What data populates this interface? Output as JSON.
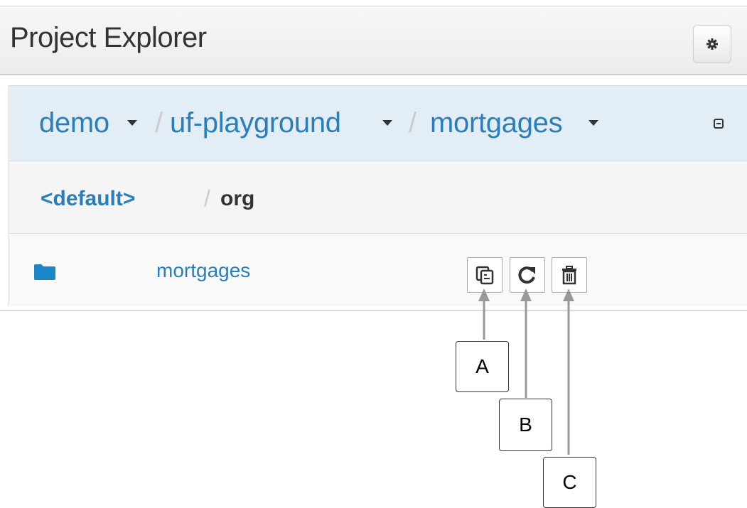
{
  "header": {
    "title": "Project Explorer",
    "settings_icon": "gear-icon"
  },
  "breadcrumbs": {
    "items": [
      {
        "label": "demo",
        "has_dropdown": true
      },
      {
        "label": "uf-playground",
        "has_dropdown": true
      },
      {
        "label": "mortgages",
        "has_dropdown": true
      }
    ],
    "separator": "/",
    "collapse_icon": "collapse-icon"
  },
  "path": {
    "root": "<default>",
    "separator": "/",
    "current": "org"
  },
  "rows": [
    {
      "icon": "folder-icon",
      "label": "mortgages",
      "actions": [
        {
          "icon": "copy-icon"
        },
        {
          "icon": "refresh-icon"
        },
        {
          "icon": "trash-icon"
        }
      ]
    }
  ],
  "callouts": [
    {
      "label": "A"
    },
    {
      "label": "B"
    },
    {
      "label": "C"
    }
  ],
  "colors": {
    "link": "#2a7fba",
    "breadcrumb_bg": "#e2edf6",
    "text": "#333333"
  }
}
